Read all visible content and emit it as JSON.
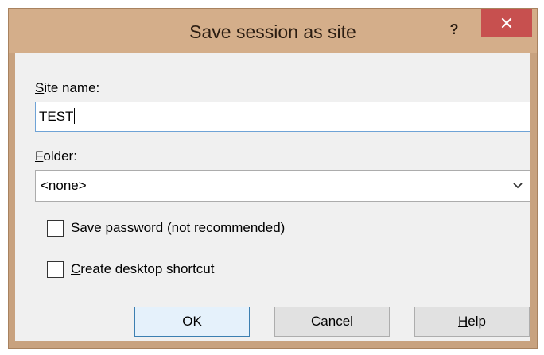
{
  "dialog": {
    "title": "Save session as site",
    "help_glyph": "?",
    "close_icon": "close-icon"
  },
  "site_name": {
    "label_first": "S",
    "label_rest": "ite name:",
    "value": "TEST"
  },
  "folder": {
    "label_first": "F",
    "label_rest": "older:",
    "selected": "<none>"
  },
  "options": {
    "save_password": {
      "label_before": "Save ",
      "label_accel": "p",
      "label_after": "assword (not recommended)",
      "checked": false
    },
    "desktop_shortcut": {
      "label_accel": "C",
      "label_after": "reate desktop shortcut",
      "checked": false
    }
  },
  "buttons": {
    "ok": "OK",
    "cancel": "Cancel",
    "help_accel": "H",
    "help_rest": "elp"
  },
  "colors": {
    "titlebar": "#d4ae8a",
    "close_button": "#c7504f",
    "focus_border": "#6fa3d6"
  }
}
